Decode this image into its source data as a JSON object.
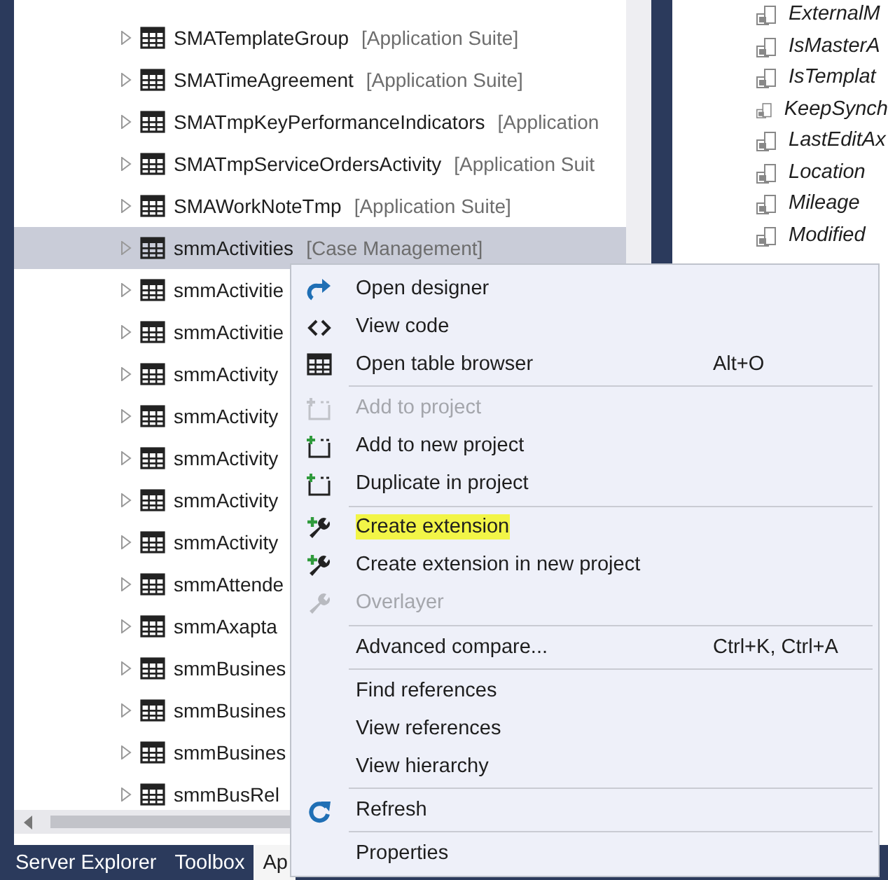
{
  "tree": {
    "rows": [
      {
        "name": "SMATemplateGroup",
        "module": "[Application Suite]",
        "selected": false
      },
      {
        "name": "SMATimeAgreement",
        "module": "[Application Suite]",
        "selected": false
      },
      {
        "name": "SMATmpKeyPerformanceIndicators",
        "module": "[Application",
        "selected": false
      },
      {
        "name": "SMATmpServiceOrdersActivity",
        "module": "[Application Suit",
        "selected": false
      },
      {
        "name": "SMAWorkNoteTmp",
        "module": "[Application Suite]",
        "selected": false
      },
      {
        "name": "smmActivities",
        "module": "[Case Management]",
        "selected": true
      },
      {
        "name": "smmActivitie",
        "selected": false
      },
      {
        "name": "smmActivitie",
        "selected": false
      },
      {
        "name": "smmActivity",
        "selected": false
      },
      {
        "name": "smmActivity",
        "selected": false
      },
      {
        "name": "smmActivity",
        "selected": false
      },
      {
        "name": "smmActivity",
        "selected": false
      },
      {
        "name": "smmActivity",
        "selected": false
      },
      {
        "name": "smmAttende",
        "selected": false
      },
      {
        "name": "smmAxapta",
        "selected": false
      },
      {
        "name": "smmBusines",
        "selected": false
      },
      {
        "name": "smmBusines",
        "selected": false
      },
      {
        "name": "smmBusines",
        "selected": false
      },
      {
        "name": "smmBusRel",
        "selected": false
      }
    ]
  },
  "fields": [
    "ExternalM",
    "IsMasterA",
    "IsTemplat",
    "KeepSynch",
    "LastEditAx",
    "Location",
    "Mileage",
    "Modified"
  ],
  "bottom_tabs": [
    {
      "label": "Server Explorer",
      "selected": false
    },
    {
      "label": "Toolbox",
      "selected": false
    },
    {
      "label": "Ap",
      "selected": true
    }
  ],
  "context_menu": {
    "groups": [
      [
        {
          "label": "Open designer",
          "kind": "designer",
          "disabled": false
        },
        {
          "label": "View code",
          "kind": "code",
          "disabled": false
        },
        {
          "label": "Open table browser",
          "kind": "table",
          "shortcut": "Alt+O",
          "disabled": false
        }
      ],
      [
        {
          "label": "Add to project",
          "kind": "project",
          "disabled": true
        },
        {
          "label": "Add to new project",
          "kind": "project",
          "disabled": false
        },
        {
          "label": "Duplicate in project",
          "kind": "project",
          "disabled": false
        }
      ],
      [
        {
          "label": "Create extension",
          "kind": "extension",
          "disabled": false,
          "highlighted": true
        },
        {
          "label": "Create extension in new project",
          "kind": "extension",
          "disabled": false,
          "highlighted": false
        },
        {
          "label": "Overlayer",
          "kind": "overlayer",
          "disabled": true
        }
      ],
      [
        {
          "label": "Advanced compare...",
          "kind": "plain",
          "shortcut": "Ctrl+K, Ctrl+A",
          "disabled": false
        }
      ],
      [
        {
          "label": "Find references",
          "kind": "plain",
          "disabled": false
        },
        {
          "label": "View references",
          "kind": "plain",
          "disabled": false
        },
        {
          "label": "View hierarchy",
          "kind": "plain",
          "disabled": false
        }
      ],
      [
        {
          "label": "Refresh",
          "kind": "refresh",
          "disabled": false
        }
      ],
      [
        {
          "label": "Properties",
          "kind": "plain",
          "disabled": false
        }
      ]
    ]
  }
}
